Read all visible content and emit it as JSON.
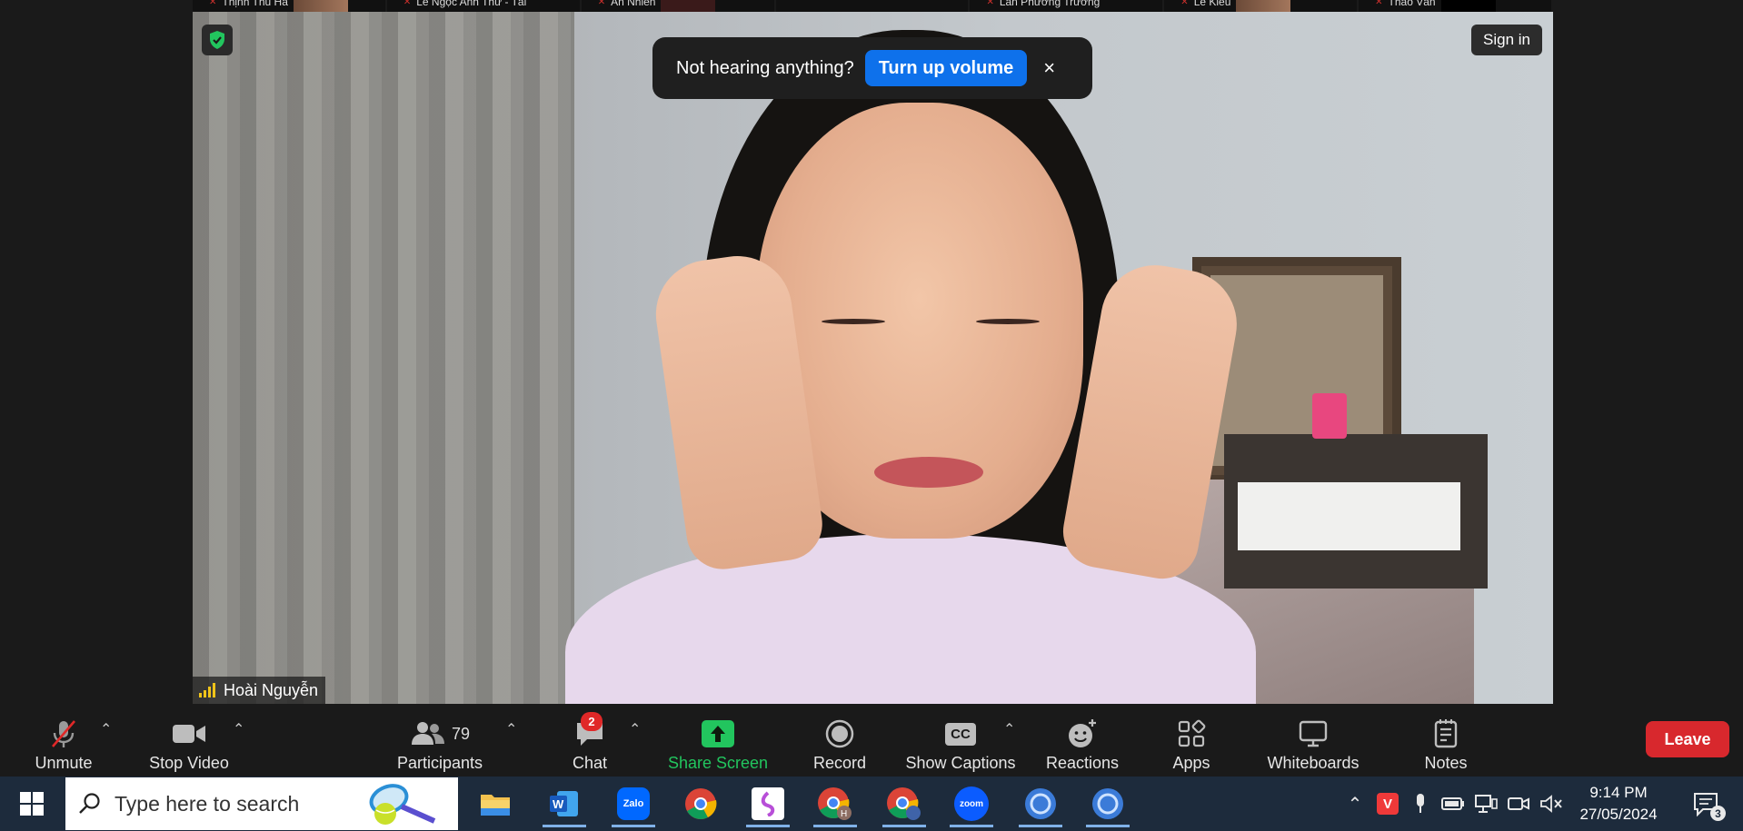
{
  "filmstrip": [
    {
      "name": "Thịnh Thu Hà"
    },
    {
      "name": "Lê Ngọc Anh Thư - Tài"
    },
    {
      "name": "An Nhiên"
    },
    {
      "name": ""
    },
    {
      "name": "Lan Phương Trương"
    },
    {
      "name": "Lê Kiều"
    },
    {
      "name": "Thảo Vân"
    }
  ],
  "video": {
    "participant_name": "Hoài Nguyễn",
    "sign_in_label": "Sign in",
    "notice_text": "Not hearing anything?",
    "notice_button": "Turn up volume",
    "notice_close": "×"
  },
  "toolbar": {
    "unmute": "Unmute",
    "stop_video": "Stop Video",
    "participants": "Participants",
    "participants_count": "79",
    "chat": "Chat",
    "chat_badge": "2",
    "share_screen": "Share Screen",
    "record": "Record",
    "show_captions": "Show Captions",
    "reactions": "Reactions",
    "apps": "Apps",
    "whiteboards": "Whiteboards",
    "notes": "Notes",
    "leave": "Leave",
    "cc_label": "CC",
    "share_color": "#22c55e",
    "leave_color": "#d8282d"
  },
  "taskbar": {
    "search_placeholder": "Type here to search",
    "zalo_label": "Zalo",
    "zoom_label": "zoom",
    "time": "9:14 PM",
    "date": "27/05/2024",
    "notification_count": "3"
  }
}
